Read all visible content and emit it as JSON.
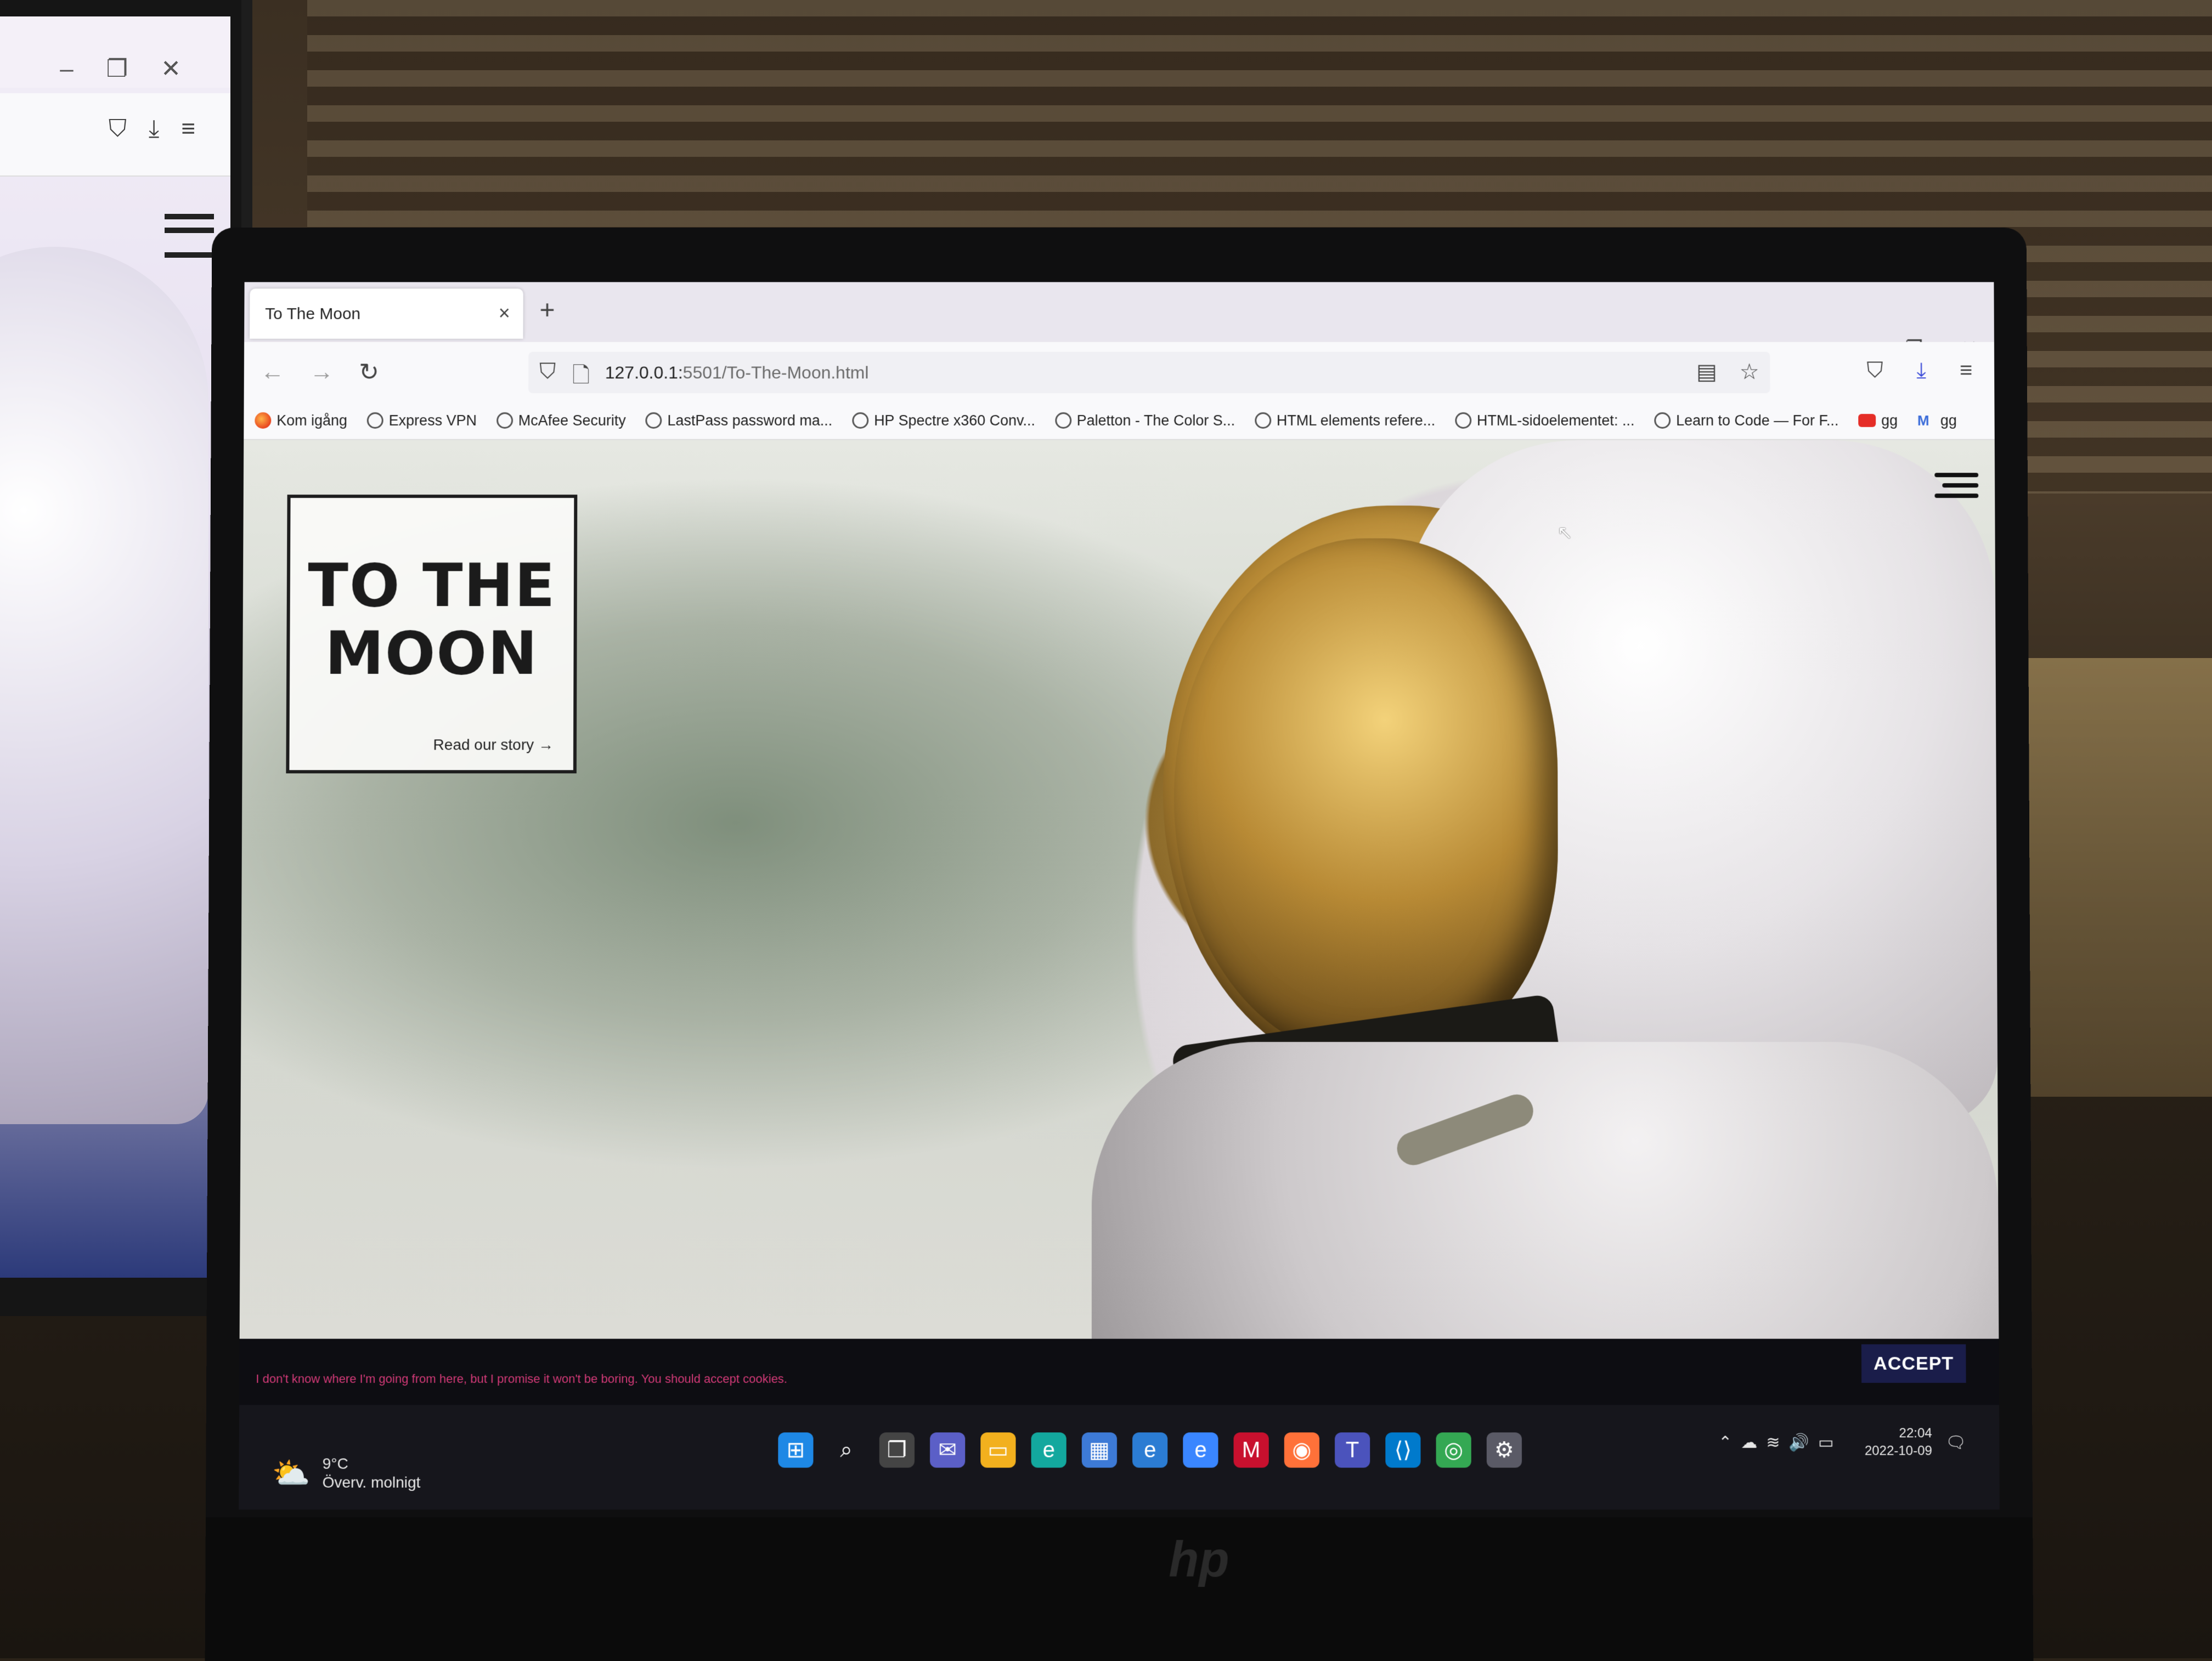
{
  "browser": {
    "tab_title": "To The Moon",
    "tab_close": "×",
    "new_tab": "+",
    "url_host": "127.0.0.1:",
    "url_path": "5501/To-The-Moon.html"
  },
  "bookmarks": [
    {
      "label": "Kom igång",
      "icon": "firefox-icon"
    },
    {
      "label": "Express VPN",
      "icon": "globe-icon"
    },
    {
      "label": "McAfee Security",
      "icon": "globe-icon"
    },
    {
      "label": "LastPass password ma...",
      "icon": "globe-icon"
    },
    {
      "label": "HP Spectre x360 Conv...",
      "icon": "globe-icon"
    },
    {
      "label": "Paletton - The Color S...",
      "icon": "globe-icon"
    },
    {
      "label": "HTML elements refere...",
      "icon": "globe-icon"
    },
    {
      "label": "HTML-sidoelementet: ...",
      "icon": "globe-icon"
    },
    {
      "label": "Learn to Code — For F...",
      "icon": "globe-icon"
    },
    {
      "label": "gg",
      "icon": "youtube-icon"
    },
    {
      "label": "gg",
      "icon": "gmail-icon"
    }
  ],
  "hero": {
    "title_line1": "TO THE",
    "title_line2": "MOON",
    "link_text": "Read our story",
    "link_arrow": "→"
  },
  "cookie": {
    "message": "I don't know where I'm going from here, but I promise it won't be boring. You should accept cookies.",
    "accept_label": "ACCEPT"
  },
  "taskbar": {
    "weather_temp": "9°C",
    "weather_desc": "Överv. molnigt",
    "time": "22:04",
    "date": "2022-10-09"
  },
  "colors": {
    "cookie_text": "#d43a78",
    "accept_bg": "#1a1d4a",
    "download_icon": "#3b4bd8"
  }
}
